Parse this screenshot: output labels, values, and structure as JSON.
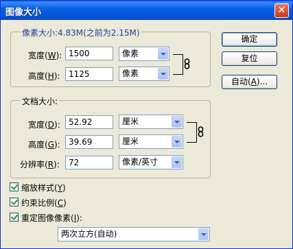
{
  "window": {
    "title": "图像大小",
    "close_symbol": "✕"
  },
  "pixel_group": {
    "legend": "像素大小:4.83M(之前为2.15M)",
    "width": {
      "label_pre": "宽度(",
      "accel": "W",
      "label_post": "):",
      "value": "1500",
      "unit": "像素"
    },
    "height": {
      "label_pre": "高度(",
      "accel": "H",
      "label_post": "):",
      "value": "1125",
      "unit": "像素"
    }
  },
  "doc_group": {
    "legend": "文档大小:",
    "width": {
      "label_pre": "宽度(",
      "accel": "D",
      "label_post": "):",
      "value": "52.92",
      "unit": "厘米"
    },
    "height": {
      "label_pre": "高度(",
      "accel": "G",
      "label_post": "):",
      "value": "39.69",
      "unit": "厘米"
    },
    "resolution": {
      "label_pre": "分辨率(",
      "accel": "R",
      "label_post": "):",
      "value": "72",
      "unit": "像素/英寸"
    }
  },
  "buttons": {
    "ok": "确定",
    "reset": "复位",
    "auto_pre": "自动(",
    "auto_accel": "A",
    "auto_post": ")..."
  },
  "options": {
    "scale_styles": {
      "label_pre": "缩放样式(",
      "accel": "Y",
      "label_post": ")",
      "checked": true
    },
    "constrain": {
      "label_pre": "约束比例(",
      "accel": "C",
      "label_post": ")",
      "checked": true
    },
    "resample": {
      "label_pre": "重定图像像素(",
      "accel": "I",
      "label_post": "):",
      "checked": true
    },
    "method": "两次立方(自动)"
  }
}
